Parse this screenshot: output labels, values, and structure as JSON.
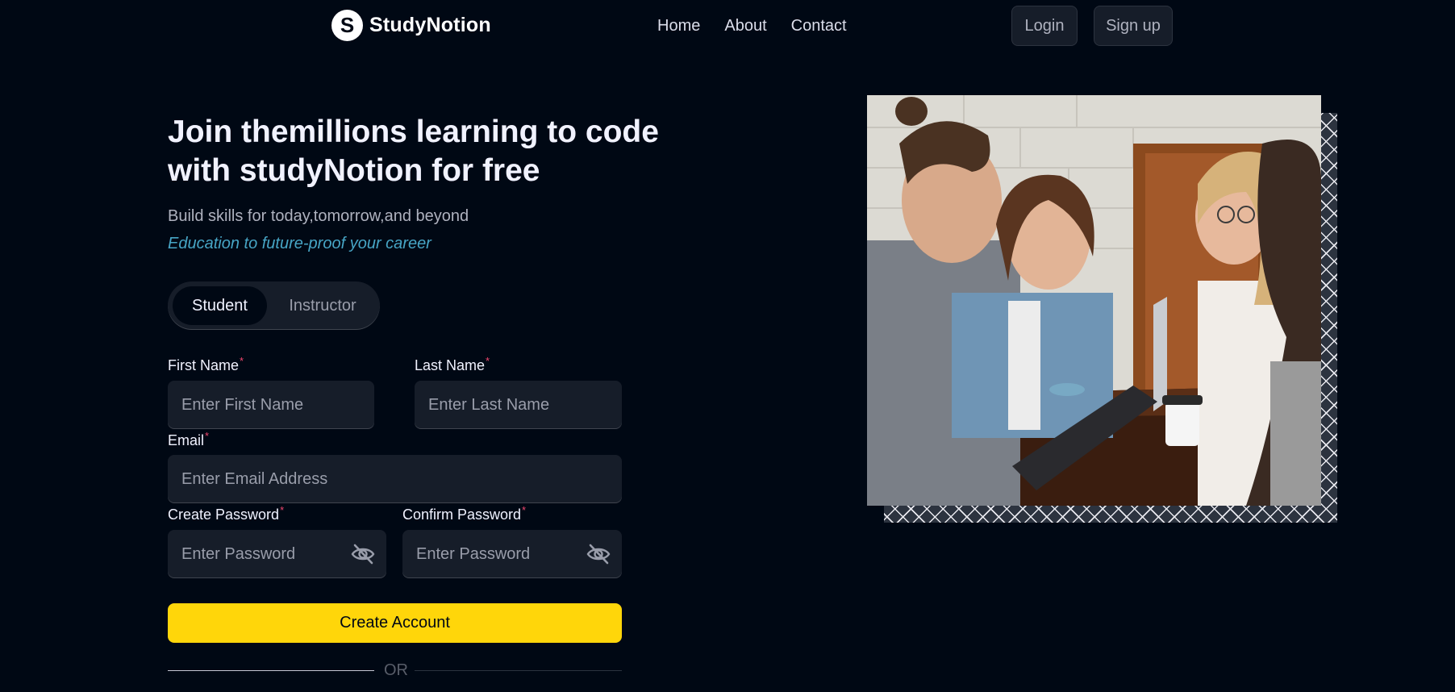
{
  "nav": {
    "logo_letter": "S",
    "brand": "StudyNotion",
    "links": [
      "Home",
      "About",
      "Contact"
    ],
    "login": "Login",
    "signup": "Sign up"
  },
  "hero": {
    "heading": "Join themillions learning to code with studyNotion for free",
    "subtitle": "Build skills for today,tomorrow,and beyond",
    "tagline": "Education to future-proof your career"
  },
  "roles": {
    "student": "Student",
    "instructor": "Instructor",
    "selected": "Student"
  },
  "form": {
    "required_mark": "*",
    "first_name_label": "First Name",
    "first_name_placeholder": "Enter First Name",
    "last_name_label": "Last Name",
    "last_name_placeholder": "Enter Last Name",
    "email_label": "Email",
    "email_placeholder": "Enter Email Address",
    "password_label": "Create Password",
    "password_placeholder": "Enter Password",
    "confirm_label": "Confirm Password",
    "confirm_placeholder": "Enter Password",
    "submit": "Create Account",
    "or": "OR"
  },
  "icons": {
    "password_toggle": "eye-slash-icon",
    "logo": "studynotion-logo-icon"
  },
  "colors": {
    "background": "#000814",
    "accent": "#ffd60a",
    "field": "#161d29",
    "tagline": "#47a5c5",
    "required": "#ef476f"
  }
}
